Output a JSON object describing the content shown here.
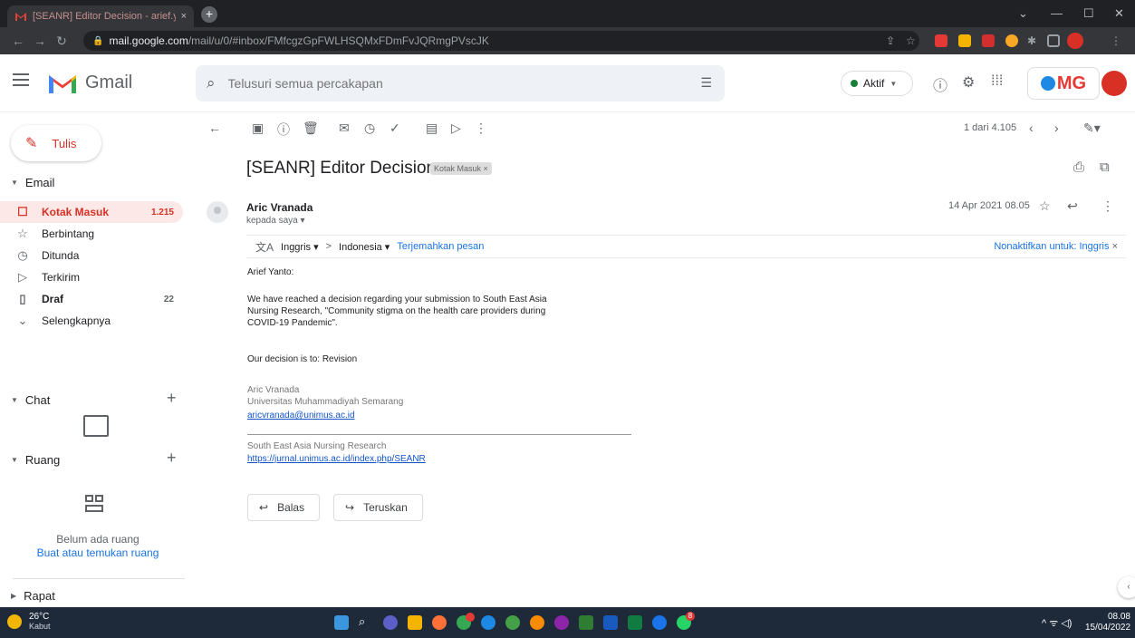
{
  "browser": {
    "tab_title": "[SEANR] Editor Decision - arief.y",
    "tab_close": "×",
    "new_tab": "+",
    "url_host": "mail.google.com",
    "url_path": "/mail/u/0/#inbox/FMfcgzGpFWLHSQMxFDmFvJQRmgPVscJK",
    "window_controls": [
      "⌄",
      "—",
      "☐",
      "✕"
    ]
  },
  "header": {
    "app_name": "Gmail",
    "search_placeholder": "Telusuri semua percakapan",
    "status_label": "Aktif",
    "org_logo_text": "MG"
  },
  "sidebar": {
    "compose_label": "Tulis",
    "email_section": "Email",
    "items": [
      {
        "label": "Kotak Masuk",
        "count": "1.215",
        "icon": "inbox-icon",
        "glyph": "☐"
      },
      {
        "label": "Berbintang",
        "count": "",
        "icon": "star-icon",
        "glyph": "☆"
      },
      {
        "label": "Ditunda",
        "count": "",
        "icon": "clock-icon",
        "glyph": "◷"
      },
      {
        "label": "Terkirim",
        "count": "",
        "icon": "send-icon",
        "glyph": "▷"
      },
      {
        "label": "Draf",
        "count": "22",
        "icon": "draft-icon",
        "glyph": "▯"
      },
      {
        "label": "Selengkapnya",
        "count": "",
        "icon": "chevron-down-icon",
        "glyph": "⌄"
      }
    ],
    "chat_section": "Chat",
    "rooms_section": "Ruang",
    "rooms_empty": "Belum ada ruang",
    "rooms_link": "Buat atau temukan ruang",
    "meet_section": "Rapat"
  },
  "toolbar": {
    "pager": "1 dari 4.105"
  },
  "message": {
    "subject": "[SEANR] Editor Decision",
    "label_chip": "Kotak Masuk ×",
    "sender": "Aric Vranada",
    "to_line": "kepada saya ▾",
    "date": "14 Apr 2021 08.05",
    "translate_from": "Inggris ▾",
    "translate_arrow": ">",
    "translate_to": "Indonesia ▾",
    "translate_link": "Terjemahkan pesan",
    "translate_disable": "Nonaktifkan untuk: Inggris",
    "translate_disable_x": "×",
    "greeting": "Arief Yanto:",
    "para1_line1": "We have reached a decision regarding your submission to South East Asia",
    "para1_line2": "Nursing Research, \"Community stigma on the health care providers during",
    "para1_line3": "COVID-19 Pandemic\".",
    "decision": "Our decision is to: Revision",
    "sig_name": "Aric Vranada",
    "sig_org": "Universitas Muhammadiyah Semarang",
    "sig_email": "aricvranada@unimus.ac.id",
    "journal_name": "South East Asia Nursing Research",
    "journal_url": "https://jurnal.unimus.ac.id/index.php/SEANR",
    "reply_label": "Balas",
    "forward_label": "Teruskan"
  },
  "taskbar": {
    "temp": "26°C",
    "weather": "Kabut",
    "badge_1": "",
    "badge_2": "8",
    "time": "08.08",
    "date": "15/04/2022"
  },
  "colors": {
    "accent_red": "#d93025",
    "link_blue": "#1a73e8",
    "active_bg": "#fce8e6"
  }
}
